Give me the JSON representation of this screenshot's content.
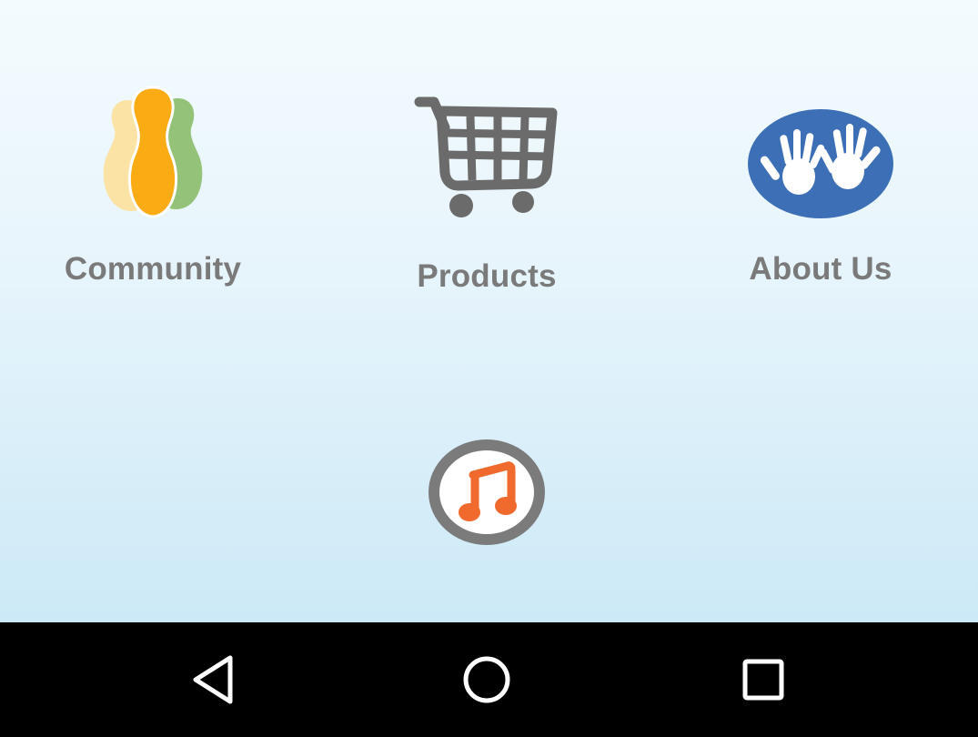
{
  "colors": {
    "background_top": "#f4fbfe",
    "background_bottom": "#cce9f7",
    "label_text": "#7a7a7a",
    "nav_bar": "#000000",
    "nav_icons": "#ffffff"
  },
  "menu": {
    "items": [
      {
        "label": "Community",
        "icon": "people-icon"
      },
      {
        "label": "Products",
        "icon": "shopping-cart-icon"
      },
      {
        "label": "About Us",
        "icon": "hands-icon"
      },
      {
        "label": "",
        "icon": "music-note-icon"
      }
    ]
  },
  "navigation_bar": {
    "buttons": [
      {
        "icon": "back-triangle-icon"
      },
      {
        "icon": "home-circle-icon"
      },
      {
        "icon": "recents-square-icon"
      }
    ]
  }
}
